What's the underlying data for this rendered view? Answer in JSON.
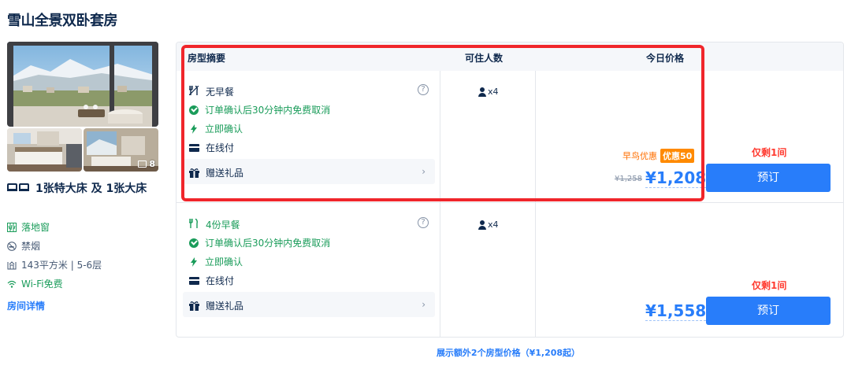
{
  "room": {
    "title": "雪山全景双卧套房",
    "photo_count": "8",
    "bed": "1张特大床 及 1张大床",
    "features": [
      {
        "icon": "window-icon",
        "label": "落地窗",
        "color": "#1a9c5a"
      },
      {
        "icon": "no-smoking-icon",
        "label": "禁烟",
        "color": "#455873"
      },
      {
        "icon": "area-icon",
        "label": "143平方米 | 5-6层",
        "color": "#455873"
      },
      {
        "icon": "wifi-icon",
        "label": "Wi-Fi免费",
        "color": "#1a9c5a"
      }
    ],
    "detail_link": "房间详情"
  },
  "table": {
    "headers": {
      "summary": "房型摘要",
      "occupancy": "可住人数",
      "price": "今日价格"
    },
    "rows": [
      {
        "meal": "无早餐",
        "cancel": "订单确认后30分钟内免费取消",
        "confirm": "立即确认",
        "pay": "在线付",
        "gift": "赠送礼品",
        "occupancy": "x4",
        "promo_label": "早鸟优惠",
        "discount_tag": "优惠50",
        "original_price": "¥1,258",
        "price": "¥1,208",
        "remaining": "仅剩1间",
        "book_label": "预订"
      },
      {
        "meal": "4份早餐",
        "cancel": "订单确认后30分钟内免费取消",
        "confirm": "立即确认",
        "pay": "在线付",
        "gift": "赠送礼品",
        "occupancy": "x4",
        "price": "¥1,558",
        "remaining": "仅剩1间",
        "book_label": "预订"
      }
    ]
  },
  "more_link": "展示额外2个房型价格（¥1,208起）",
  "colors": {
    "accent": "#287dfa",
    "green": "#1a9c5a",
    "red": "#ff3b30",
    "highlight": "#f0262b",
    "promo": "#ff8a00"
  }
}
